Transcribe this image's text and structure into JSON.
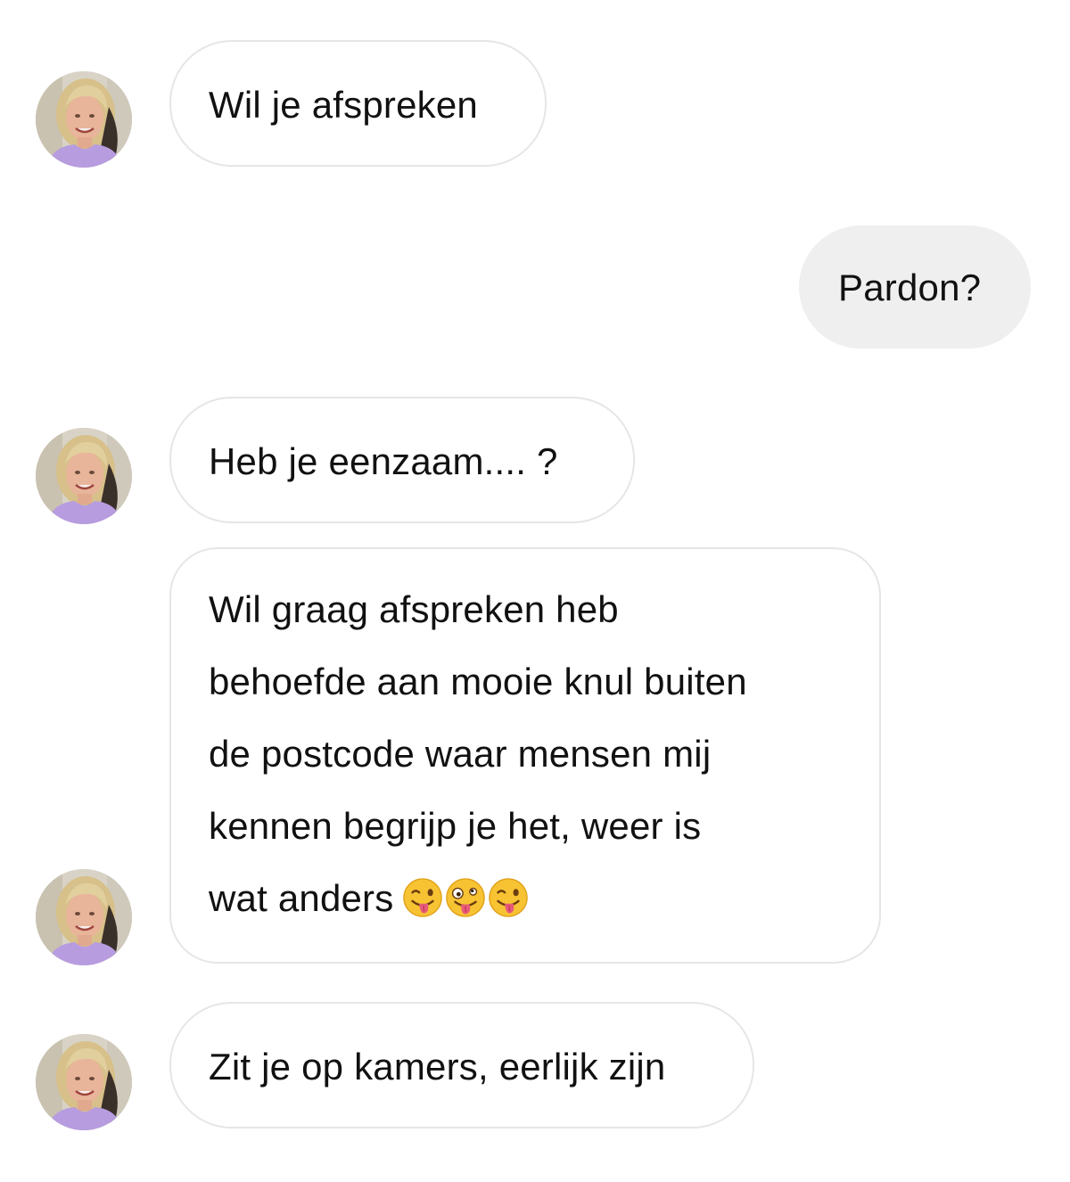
{
  "messages": [
    {
      "side": "incoming",
      "text": "Wil je afspreken"
    },
    {
      "side": "outgoing",
      "text": "Pardon?"
    },
    {
      "side": "incoming",
      "text": "Heb je eenzaam.... ?"
    },
    {
      "side": "incoming",
      "lines": [
        "Wil graag afspreken heb",
        "behoefde aan mooie knul buiten",
        "de postcode waar mensen mij",
        "kennen begrijp je het, weer is",
        "wat anders"
      ],
      "emojis": [
        "winking-face-with-tongue",
        "zany-face",
        "winking-face-with-tongue"
      ]
    },
    {
      "side": "incoming",
      "text": "Zit je op kamers, eerlijk zijn"
    }
  ],
  "colors": {
    "incoming_bubble": "#ffffff",
    "incoming_border": "#e6e6e6",
    "outgoing_bubble": "#efefef",
    "text": "#111111",
    "avatar_shirt": "#b79ce0"
  }
}
